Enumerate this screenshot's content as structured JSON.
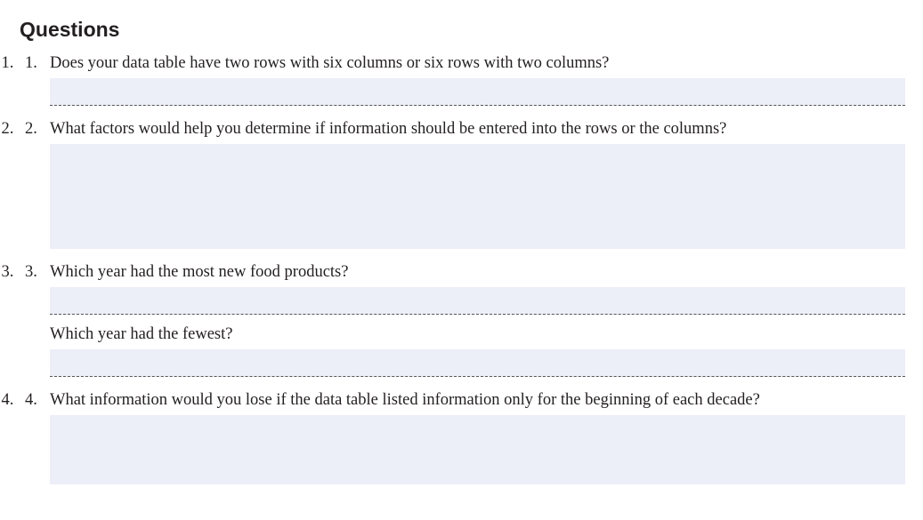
{
  "heading": "Questions",
  "questions": {
    "q1": {
      "text": "Does your data table have two rows with six columns or six rows with two columns?"
    },
    "q2": {
      "text": "What factors would help you determine if information should be entered into the rows or the columns?"
    },
    "q3": {
      "text_a": "Which year had the most new food products?",
      "text_b": "Which year had the fewest?"
    },
    "q4": {
      "text": "What information would you lose if the data table listed information only for the beginning of each decade?"
    }
  }
}
